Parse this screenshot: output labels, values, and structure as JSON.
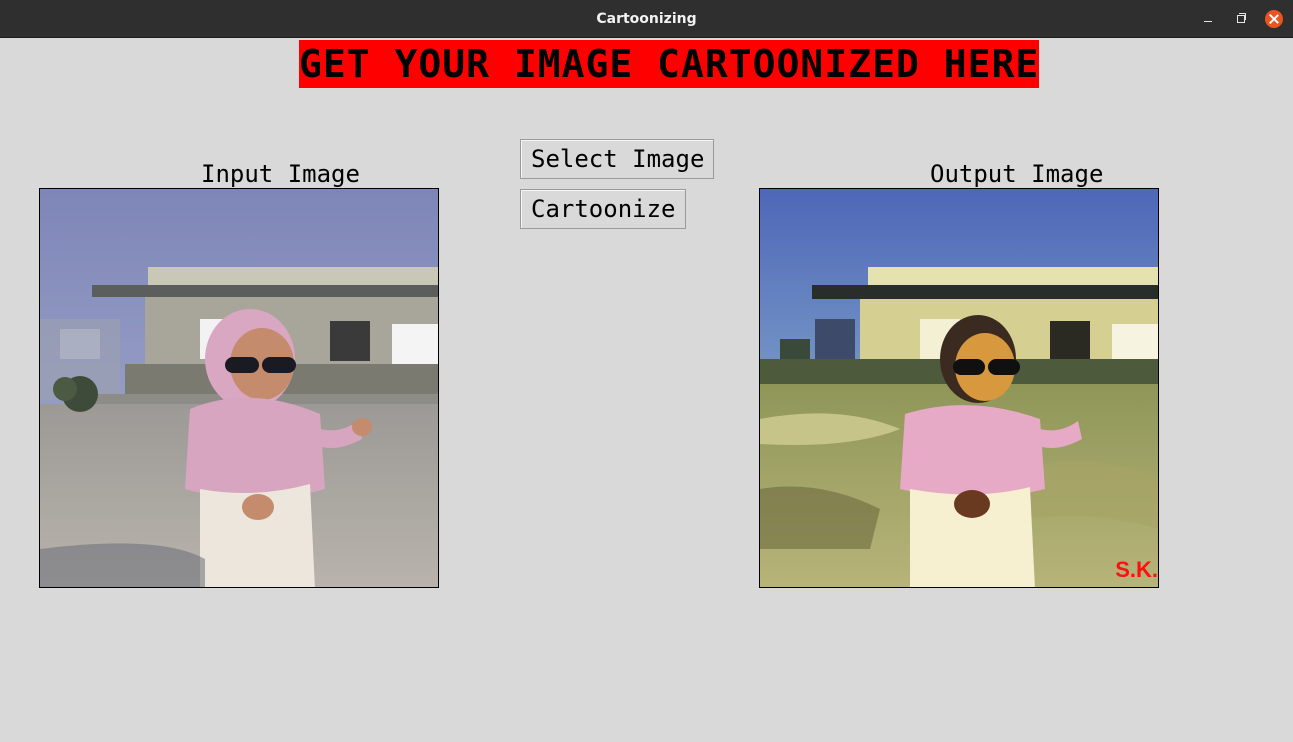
{
  "window": {
    "title": "Cartoonizing"
  },
  "banner": {
    "text": "GET YOUR IMAGE CARTOONIZED HERE!",
    "bg_color": "#ff0000"
  },
  "input_panel": {
    "label": "Input Image"
  },
  "output_panel": {
    "label": "Output Image",
    "watermark": "S.K."
  },
  "buttons": {
    "select_image": "Select Image",
    "cartoonize": "Cartoonize"
  },
  "icons": {
    "minimize": "minimize-icon",
    "maximize": "restore-icon",
    "close": "close-icon"
  },
  "colors": {
    "window_bg": "#d9d9d9",
    "titlebar_bg": "#2f2f2f",
    "close_button": "#e95420"
  }
}
